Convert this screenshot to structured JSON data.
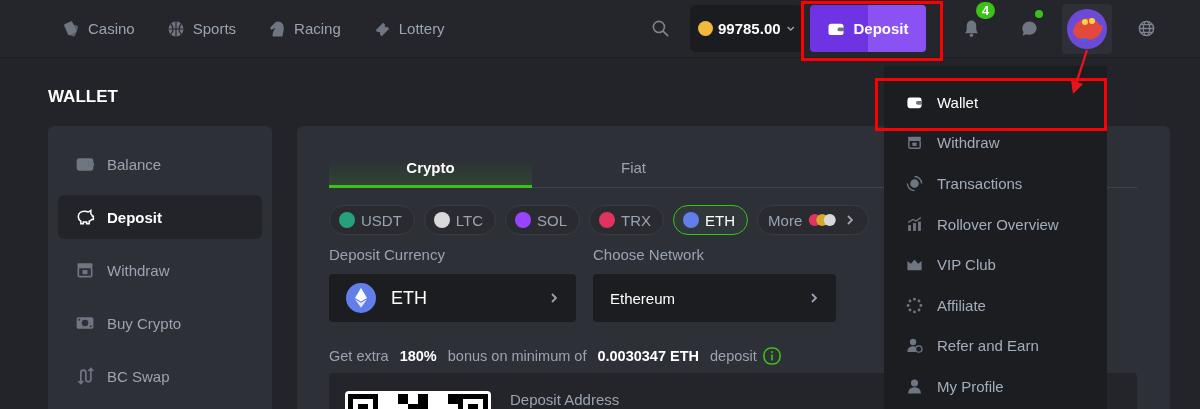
{
  "header": {
    "nav": [
      {
        "label": "Casino"
      },
      {
        "label": "Sports"
      },
      {
        "label": "Racing"
      },
      {
        "label": "Lottery"
      }
    ],
    "balance": "99785.00",
    "deposit_button": {
      "label": "Deposit",
      "highlighted": true
    },
    "notifications_badge": "4",
    "chat_online": true
  },
  "page_title": "WALLET",
  "sidebar": {
    "items": [
      {
        "label": "Balance",
        "selected": false
      },
      {
        "label": "Deposit",
        "selected": true
      },
      {
        "label": "Withdraw",
        "selected": false
      },
      {
        "label": "Buy Crypto",
        "selected": false
      },
      {
        "label": "BC Swap",
        "selected": false
      }
    ]
  },
  "deposit": {
    "tabs": [
      {
        "label": "Crypto",
        "selected": true
      },
      {
        "label": "Fiat",
        "selected": false
      }
    ],
    "coins": [
      {
        "label": "USDT",
        "color": "#26a17b",
        "selected": false
      },
      {
        "label": "LTC",
        "color": "#d9d9d9",
        "selected": false
      },
      {
        "label": "SOL",
        "color": "#9945ff",
        "selected": false
      },
      {
        "label": "TRX",
        "color": "#e0335e",
        "selected": false
      },
      {
        "label": "ETH",
        "color": "#627eea",
        "selected": true
      }
    ],
    "more_button": {
      "label": "More"
    },
    "currency_label": "Deposit Currency",
    "currency": {
      "value": "ETH",
      "color": "#627eea"
    },
    "network_label": "Choose Network",
    "network": {
      "value": "Ethereum"
    },
    "bonus": "Get extra **180%** bonus on minimum of **0.0030347 ETH** deposit",
    "address_label": "Deposit Address"
  },
  "menu": {
    "items": [
      {
        "label": "Wallet",
        "selected": true,
        "highlighted": true
      },
      {
        "label": "Withdraw",
        "selected": false,
        "highlighted": false
      },
      {
        "label": "Transactions",
        "selected": false,
        "highlighted": false
      },
      {
        "label": "Rollover Overview",
        "selected": false,
        "highlighted": false
      },
      {
        "label": "VIP Club",
        "selected": false,
        "highlighted": false
      },
      {
        "label": "Affiliate",
        "selected": false,
        "highlighted": false
      },
      {
        "label": "Refer and Earn",
        "selected": false,
        "highlighted": false
      },
      {
        "label": "My Profile",
        "selected": false,
        "highlighted": false
      }
    ]
  }
}
